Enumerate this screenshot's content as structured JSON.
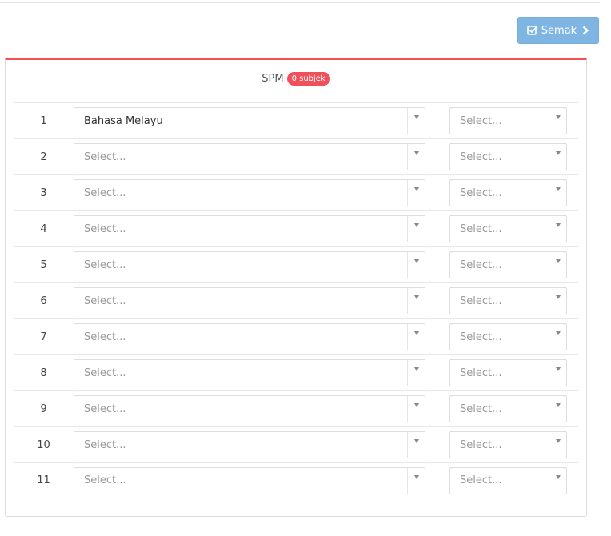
{
  "toolbar": {
    "semak_label": "Semak"
  },
  "panel": {
    "title": "SPM",
    "badge": "0 subjek"
  },
  "rows": [
    {
      "num": "1",
      "subject": "Bahasa Melayu",
      "grade": "Select..."
    },
    {
      "num": "2",
      "subject": "Select...",
      "grade": "Select..."
    },
    {
      "num": "3",
      "subject": "Select...",
      "grade": "Select..."
    },
    {
      "num": "4",
      "subject": "Select...",
      "grade": "Select..."
    },
    {
      "num": "5",
      "subject": "Select...",
      "grade": "Select..."
    },
    {
      "num": "6",
      "subject": "Select...",
      "grade": "Select..."
    },
    {
      "num": "7",
      "subject": "Select...",
      "grade": "Select..."
    },
    {
      "num": "8",
      "subject": "Select...",
      "grade": "Select..."
    },
    {
      "num": "9",
      "subject": "Select...",
      "grade": "Select..."
    },
    {
      "num": "10",
      "subject": "Select...",
      "grade": "Select..."
    },
    {
      "num": "11",
      "subject": "Select...",
      "grade": "Select..."
    }
  ],
  "icons": {
    "button_check": "check-square-icon",
    "button_next": "chevron-right-icon",
    "select_caret": "caret-down-icon"
  },
  "colors": {
    "accent_red": "#f05050",
    "button_blue": "#7fb5e3"
  }
}
